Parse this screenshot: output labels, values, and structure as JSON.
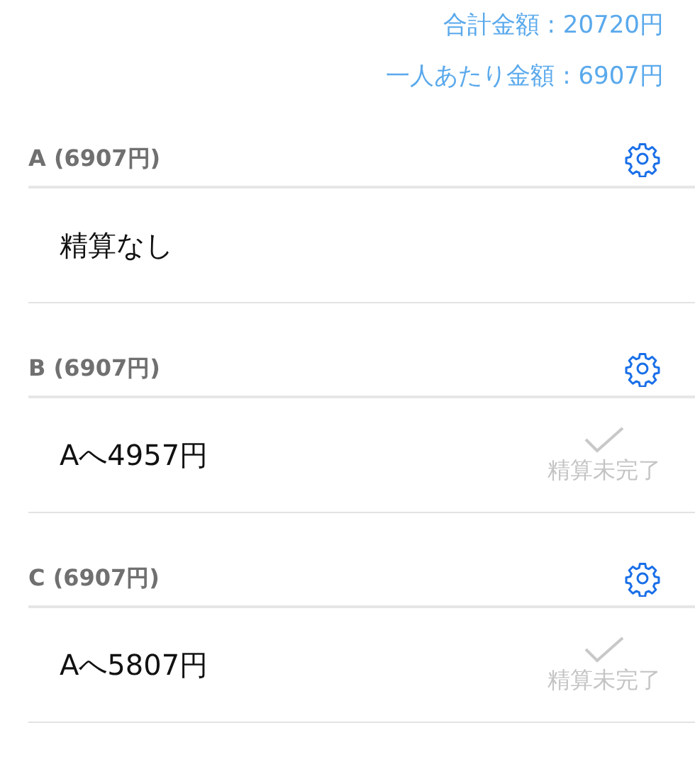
{
  "summary": {
    "total": "合計金額 : 20720円",
    "per_person": "一人あたり金額 : 6907円"
  },
  "people": [
    {
      "header": "A (6907円)",
      "row": {
        "kind": "none",
        "text": "精算なし"
      }
    },
    {
      "header": "B (6907円)",
      "row": {
        "kind": "payment",
        "text": "Aへ4957円",
        "settled": false,
        "status": "精算未完了"
      }
    },
    {
      "header": "C (6907円)",
      "row": {
        "kind": "payment",
        "text": "Aへ5807円",
        "settled": false,
        "status": "精算未完了"
      }
    }
  ]
}
